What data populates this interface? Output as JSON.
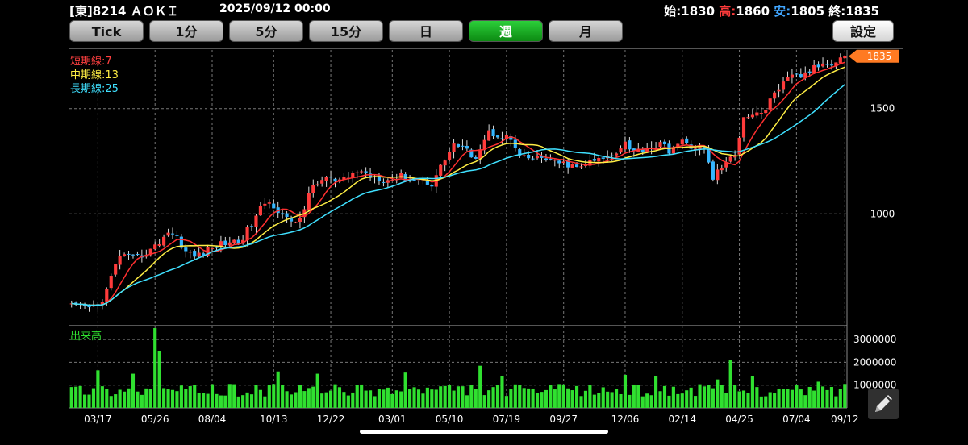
{
  "header": {
    "symbol": "[東]8214 ＡＯＫＩ",
    "datetime": "2025/09/12 00:00",
    "open_label": "始:",
    "open_value": "1830",
    "high_label": "高:",
    "high_value": "1860",
    "low_label": "安:",
    "low_value": "1805",
    "close_label": "終:",
    "close_value": "1835"
  },
  "tabs": [
    {
      "label": "Tick",
      "active": false
    },
    {
      "label": "1分",
      "active": false
    },
    {
      "label": "5分",
      "active": false
    },
    {
      "label": "15分",
      "active": false
    },
    {
      "label": "日",
      "active": false
    },
    {
      "label": "週",
      "active": true
    },
    {
      "label": "月",
      "active": false
    }
  ],
  "settings_label": "設定",
  "legend": {
    "short": "短期線:7",
    "mid": "中期線:13",
    "long": "長期線:25"
  },
  "volume_label": "出来高",
  "colors": {
    "up": "#ff3b3b",
    "down": "#34b6ff",
    "ma_short": "#ff3030",
    "ma_mid": "#ffee44",
    "ma_long": "#3fe0ff",
    "volume": "#30e030",
    "price_tag": "#ff7a22"
  },
  "chart_data": [
    {
      "type": "candlestick",
      "title": "",
      "x_tick_labels": [
        "03/17",
        "05/26",
        "08/04",
        "10/13",
        "12/22",
        "03/01",
        "05/10",
        "07/19",
        "09/27",
        "12/06",
        "02/14",
        "04/25",
        "07/04",
        "09/12"
      ],
      "y_tick_labels": [
        1000,
        1500
      ],
      "ylim": [
        650,
        1880
      ],
      "last_price_tag": 1835,
      "grid": true,
      "close_anchors": [
        [
          0,
          700
        ],
        [
          3,
          695
        ],
        [
          6,
          700
        ],
        [
          8,
          745
        ],
        [
          11,
          855
        ],
        [
          14,
          840
        ],
        [
          17,
          860
        ],
        [
          19,
          880
        ],
        [
          22,
          935
        ],
        [
          24,
          915
        ],
        [
          26,
          865
        ],
        [
          28,
          850
        ],
        [
          30,
          860
        ],
        [
          33,
          885
        ],
        [
          36,
          900
        ],
        [
          38,
          895
        ],
        [
          41,
          960
        ],
        [
          44,
          1045
        ],
        [
          46,
          1035
        ],
        [
          48,
          1000
        ],
        [
          50,
          960
        ],
        [
          52,
          985
        ],
        [
          55,
          1115
        ],
        [
          58,
          1150
        ],
        [
          60,
          1130
        ],
        [
          62,
          1135
        ],
        [
          65,
          1180
        ],
        [
          68,
          1160
        ],
        [
          70,
          1150
        ],
        [
          72,
          1140
        ],
        [
          75,
          1155
        ],
        [
          78,
          1140
        ],
        [
          80,
          1135
        ],
        [
          82,
          1125
        ],
        [
          85,
          1235
        ],
        [
          87,
          1310
        ],
        [
          90,
          1270
        ],
        [
          92,
          1250
        ],
        [
          95,
          1370
        ],
        [
          98,
          1350
        ],
        [
          100,
          1330
        ],
        [
          102,
          1240
        ],
        [
          105,
          1235
        ],
        [
          108,
          1240
        ],
        [
          110,
          1215
        ],
        [
          113,
          1210
        ],
        [
          115,
          1190
        ],
        [
          118,
          1220
        ],
        [
          120,
          1230
        ],
        [
          123,
          1255
        ],
        [
          126,
          1320
        ],
        [
          128,
          1270
        ],
        [
          131,
          1290
        ],
        [
          134,
          1305
        ],
        [
          136,
          1280
        ],
        [
          139,
          1315
        ],
        [
          141,
          1300
        ],
        [
          144,
          1280
        ],
        [
          146,
          1150
        ],
        [
          148,
          1200
        ],
        [
          151,
          1250
        ],
        [
          153,
          1460
        ],
        [
          156,
          1480
        ],
        [
          158,
          1490
        ],
        [
          160,
          1600
        ],
        [
          162,
          1650
        ],
        [
          164,
          1695
        ],
        [
          166,
          1700
        ],
        [
          168,
          1730
        ],
        [
          170,
          1770
        ],
        [
          172,
          1790
        ],
        [
          174,
          1810
        ],
        [
          176,
          1835
        ]
      ]
    },
    {
      "type": "bar",
      "title": "",
      "series_name": "出来高",
      "y_tick_labels": [
        1000000,
        2000000,
        3000000
      ],
      "ylim": [
        0,
        3500000
      ],
      "spikes": [
        [
          6,
          1650000
        ],
        [
          14,
          1500000
        ],
        [
          19,
          3500000
        ],
        [
          20,
          2500000
        ],
        [
          47,
          1600000
        ],
        [
          56,
          1500000
        ],
        [
          76,
          1550000
        ],
        [
          93,
          1850000
        ],
        [
          98,
          1400000
        ],
        [
          126,
          1450000
        ],
        [
          133,
          1400000
        ],
        [
          147,
          1250000
        ],
        [
          150,
          2100000
        ],
        [
          155,
          1400000
        ],
        [
          170,
          1150000
        ],
        [
          176,
          1050000
        ]
      ]
    }
  ]
}
